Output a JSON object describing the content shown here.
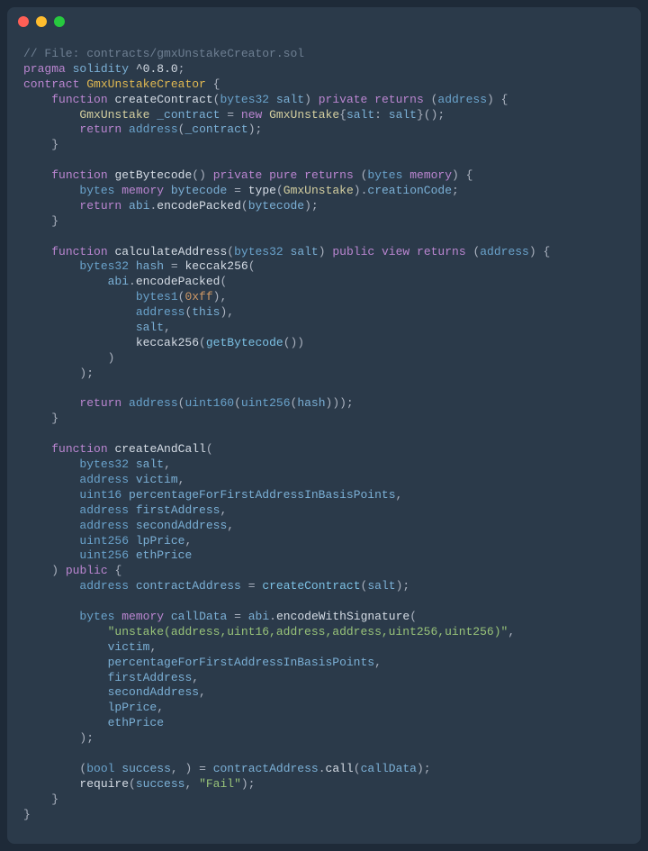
{
  "window": {
    "traffic_lights": [
      "red",
      "yellow",
      "green"
    ]
  },
  "code": {
    "file_comment": "// File: contracts/gmxUnstakeCreator.sol",
    "pragma": "pragma",
    "solidity": "solidity",
    "version": "^0.8.0",
    "contract_kw": "contract",
    "contract_name": "GmxUnstakeCreator",
    "fn_kw": "function",
    "private_kw": "private",
    "public_kw": "public",
    "pure_kw": "pure",
    "view_kw": "view",
    "returns_kw": "returns",
    "return_kw": "return",
    "new_kw": "new",
    "memory_kw": "memory",
    "createContract": {
      "name": "createContract",
      "param_type": "bytes32",
      "param_name": "salt",
      "ret_type": "address",
      "local_type": "GmxUnstake",
      "local_name": "_contract",
      "ctor_type": "GmxUnstake",
      "salt_key": "salt",
      "salt_val": "salt",
      "addr_call": "address",
      "addr_arg": "_contract"
    },
    "getBytecode": {
      "name": "getBytecode",
      "ret_type": "bytes",
      "local_type": "bytes",
      "local_name": "bytecode",
      "type_kw": "type",
      "type_arg": "GmxUnstake",
      "creationCode": "creationCode",
      "encodePacked": "encodePacked",
      "abi": "abi",
      "arg": "bytecode"
    },
    "calculateAddress": {
      "name": "calculateAddress",
      "param_type": "bytes32",
      "param_name": "salt",
      "ret_type": "address",
      "hash_type": "bytes32",
      "hash_name": "hash",
      "keccak": "keccak256",
      "abi": "abi",
      "encodePacked": "encodePacked",
      "bytes1": "bytes1",
      "ff": "0xff",
      "addr_call": "address",
      "this_kw": "this",
      "salt_arg": "salt",
      "getBytecode_call": "getBytecode",
      "uint160": "uint160",
      "uint256": "uint256",
      "hash_arg": "hash"
    },
    "createAndCall": {
      "name": "createAndCall",
      "p1_type": "bytes32",
      "p1_name": "salt",
      "p2_type": "address",
      "p2_name": "victim",
      "p3_type": "uint16",
      "p3_name": "percentageForFirstAddressInBasisPoints",
      "p4_type": "address",
      "p4_name": "firstAddress",
      "p5_type": "address",
      "p5_name": "secondAddress",
      "p6_type": "uint256",
      "p6_name": "lpPrice",
      "p7_type": "uint256",
      "p7_name": "ethPrice",
      "local1_type": "address",
      "local1_name": "contractAddress",
      "createContract_call": "createContract",
      "createContract_arg": "salt",
      "local2_type": "bytes",
      "local2_name": "callData",
      "abi": "abi",
      "encodeWithSignature": "encodeWithSignature",
      "sig": "\"unstake(address,uint16,address,address,uint256,uint256)\"",
      "arg1": "victim",
      "arg2": "percentageForFirstAddressInBasisPoints",
      "arg3": "firstAddress",
      "arg4": "secondAddress",
      "arg5": "lpPrice",
      "arg6": "ethPrice",
      "bool_type": "bool",
      "success_name": "success",
      "contractAddress_ref": "contractAddress",
      "call_method": "call",
      "callData_ref": "callData",
      "require_call": "require",
      "require_arg": "success",
      "fail_str": "\"Fail\""
    }
  }
}
